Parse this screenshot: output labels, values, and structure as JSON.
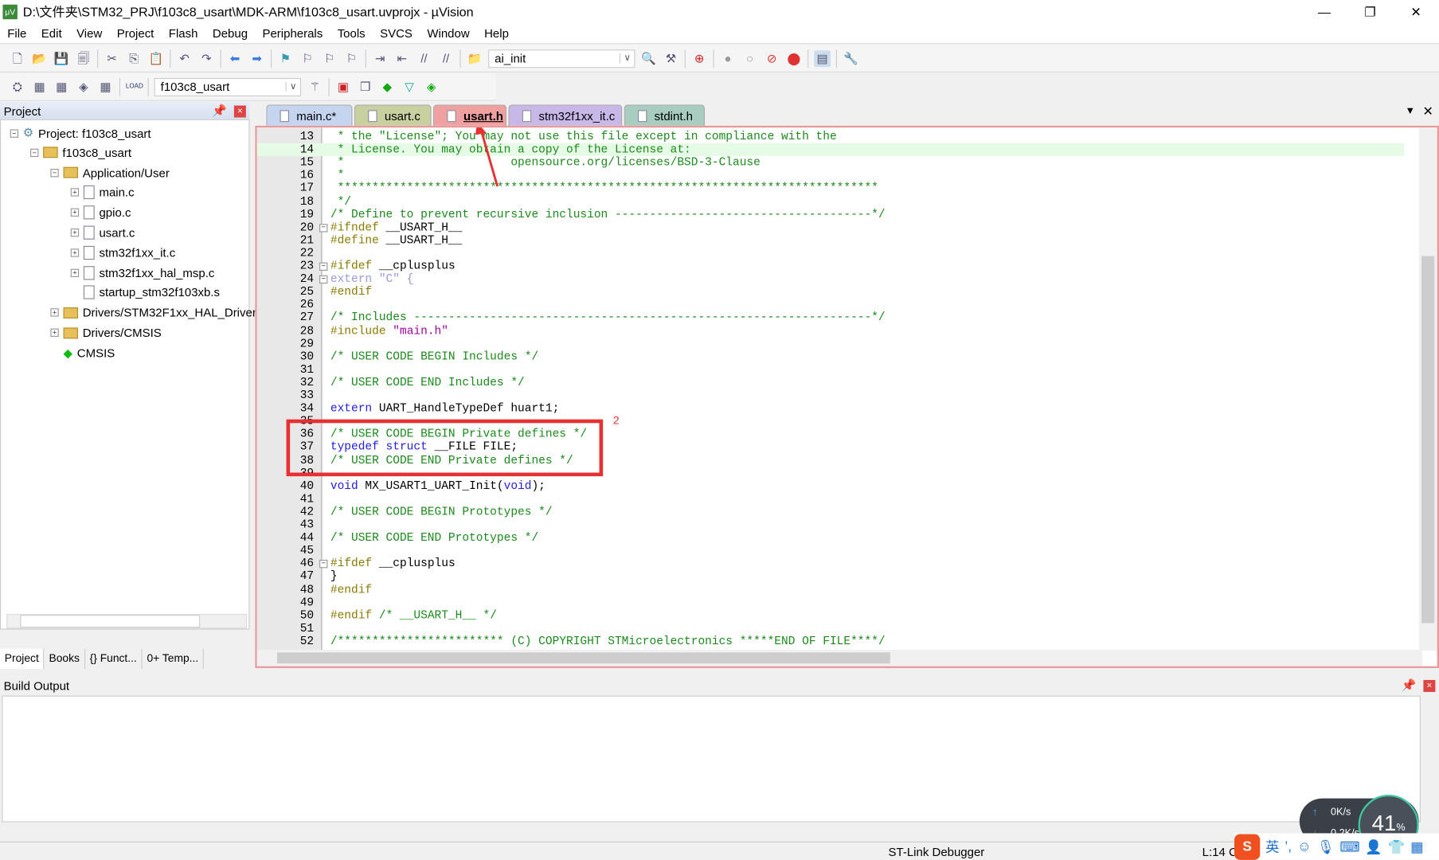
{
  "window": {
    "title": "D:\\文件夹\\STM32_PRJ\\f103c8_usart\\MDK-ARM\\f103c8_usart.uvprojx - µVision",
    "minimize": "—",
    "maximize": "❐",
    "close": "✕"
  },
  "menu": [
    "File",
    "Edit",
    "View",
    "Project",
    "Flash",
    "Debug",
    "Peripherals",
    "Tools",
    "SVCS",
    "Window",
    "Help"
  ],
  "toolbar1": {
    "find_value": "ai_init"
  },
  "toolbar2": {
    "target_value": "f103c8_usart",
    "load_label": "LOAD"
  },
  "project_panel": {
    "title": "Project",
    "tree": [
      {
        "label": "Project: f103c8_usart",
        "depth": 0,
        "expander": "−",
        "icon": "project"
      },
      {
        "label": "f103c8_usart",
        "depth": 1,
        "expander": "−",
        "icon": "target"
      },
      {
        "label": "Application/User",
        "depth": 2,
        "expander": "−",
        "icon": "folder"
      },
      {
        "label": "main.c",
        "depth": 3,
        "expander": "+",
        "icon": "file"
      },
      {
        "label": "gpio.c",
        "depth": 3,
        "expander": "+",
        "icon": "file"
      },
      {
        "label": "usart.c",
        "depth": 3,
        "expander": "+",
        "icon": "file"
      },
      {
        "label": "stm32f1xx_it.c",
        "depth": 3,
        "expander": "+",
        "icon": "file"
      },
      {
        "label": "stm32f1xx_hal_msp.c",
        "depth": 3,
        "expander": "+",
        "icon": "file"
      },
      {
        "label": "startup_stm32f103xb.s",
        "depth": 3,
        "expander": "",
        "icon": "file"
      },
      {
        "label": "Drivers/STM32F1xx_HAL_Driver",
        "depth": 2,
        "expander": "+",
        "icon": "folder"
      },
      {
        "label": "Drivers/CMSIS",
        "depth": 2,
        "expander": "+",
        "icon": "folder"
      },
      {
        "label": "CMSIS",
        "depth": 2,
        "expander": "",
        "icon": "cmsis"
      }
    ],
    "bottom_tabs": [
      "Project",
      "Books",
      "{} Funct...",
      "0+ Temp..."
    ]
  },
  "editor_tabs": [
    {
      "label": "main.c*",
      "color": "#c5d5f0"
    },
    {
      "label": "usart.c",
      "color": "#c8d0a0"
    },
    {
      "label": "usart.h",
      "color": "#f0a0a0",
      "active": true
    },
    {
      "label": "stm32f1xx_it.c",
      "color": "#c8b8e8"
    },
    {
      "label": "stdint.h",
      "color": "#a8ccc0"
    }
  ],
  "code_lines": [
    {
      "n": "13",
      "tokens": [
        [
          " * the \"License\"; You may not use this file except in compliance with the",
          "cm"
        ]
      ]
    },
    {
      "n": "14",
      "hl": true,
      "tokens": [
        [
          " * License. You may obtain a copy of the License at:",
          "cm"
        ]
      ]
    },
    {
      "n": "15",
      "tokens": [
        [
          " *                        opensource.org/licenses/BSD-3-Clause",
          "cm"
        ]
      ]
    },
    {
      "n": "16",
      "tokens": [
        [
          " *",
          "cm"
        ]
      ]
    },
    {
      "n": "17",
      "tokens": [
        [
          " ******************************************************************************",
          "cm"
        ]
      ]
    },
    {
      "n": "18",
      "tokens": [
        [
          " */",
          "cm"
        ]
      ]
    },
    {
      "n": "19",
      "tokens": [
        [
          "/* Define to prevent recursive inclusion -------------------------------------*/",
          "cm"
        ]
      ]
    },
    {
      "n": "20",
      "fold": true,
      "tokens": [
        [
          "#ifndef",
          "pp"
        ],
        [
          " __USART_H__",
          ""
        ]
      ]
    },
    {
      "n": "21",
      "tokens": [
        [
          "#define",
          "pp"
        ],
        [
          " __USART_H__",
          ""
        ]
      ]
    },
    {
      "n": "22",
      "tokens": []
    },
    {
      "n": "23",
      "fold": true,
      "tokens": [
        [
          "#ifdef",
          "pp"
        ],
        [
          " __cplusplus",
          ""
        ]
      ]
    },
    {
      "n": "24",
      "fold": true,
      "tokens": [
        [
          "extern \"C\" {",
          "fd"
        ]
      ]
    },
    {
      "n": "25",
      "tokens": [
        [
          "#endif",
          "pp"
        ]
      ]
    },
    {
      "n": "26",
      "tokens": []
    },
    {
      "n": "27",
      "tokens": [
        [
          "/* Includes ------------------------------------------------------------------*/",
          "cm"
        ]
      ]
    },
    {
      "n": "28",
      "tokens": [
        [
          "#include ",
          "pp"
        ],
        [
          "\"main.h\"",
          "st"
        ]
      ]
    },
    {
      "n": "29",
      "tokens": []
    },
    {
      "n": "30",
      "tokens": [
        [
          "/* USER CODE BEGIN Includes */",
          "cm"
        ]
      ]
    },
    {
      "n": "31",
      "tokens": []
    },
    {
      "n": "32",
      "tokens": [
        [
          "/* USER CODE END Includes */",
          "cm"
        ]
      ]
    },
    {
      "n": "33",
      "tokens": []
    },
    {
      "n": "34",
      "tokens": [
        [
          "extern",
          "kw"
        ],
        [
          " UART_HandleTypeDef huart1;",
          ""
        ]
      ]
    },
    {
      "n": "35",
      "tokens": []
    },
    {
      "n": "36",
      "tokens": [
        [
          "/* USER CODE BEGIN Private defines */",
          "cm"
        ]
      ]
    },
    {
      "n": "37",
      "tokens": [
        [
          "typedef struct",
          "kw"
        ],
        [
          " __FILE FILE;",
          ""
        ]
      ]
    },
    {
      "n": "38",
      "tokens": [
        [
          "/* USER CODE END Private defines */",
          "cm"
        ]
      ]
    },
    {
      "n": "39",
      "tokens": []
    },
    {
      "n": "40",
      "tokens": [
        [
          "void",
          "kw"
        ],
        [
          " MX_USART1_UART_Init(",
          ""
        ],
        [
          "void",
          "kw"
        ],
        [
          ");",
          ""
        ]
      ]
    },
    {
      "n": "41",
      "tokens": []
    },
    {
      "n": "42",
      "tokens": [
        [
          "/* USER CODE BEGIN Prototypes */",
          "cm"
        ]
      ]
    },
    {
      "n": "43",
      "tokens": []
    },
    {
      "n": "44",
      "tokens": [
        [
          "/* USER CODE END Prototypes */",
          "cm"
        ]
      ]
    },
    {
      "n": "45",
      "tokens": []
    },
    {
      "n": "46",
      "fold": true,
      "tokens": [
        [
          "#ifdef",
          "pp"
        ],
        [
          " __cplusplus",
          ""
        ]
      ]
    },
    {
      "n": "47",
      "tokens": [
        [
          "}",
          ""
        ]
      ]
    },
    {
      "n": "48",
      "tokens": [
        [
          "#endif",
          "pp"
        ]
      ]
    },
    {
      "n": "49",
      "tokens": []
    },
    {
      "n": "50",
      "tokens": [
        [
          "#endif",
          "pp"
        ],
        [
          " /* __USART_H__ */",
          "cm"
        ]
      ]
    },
    {
      "n": "51",
      "tokens": []
    },
    {
      "n": "52",
      "tokens": [
        [
          "/************************ (C) COPYRIGHT STMicroelectronics *****END OF FILE****/",
          "cm"
        ]
      ]
    }
  ],
  "annotation": {
    "label": "2",
    "color": "#e83030"
  },
  "build_output": {
    "title": "Build Output"
  },
  "status": {
    "debugger": "ST-Link Debugger",
    "position": "L:14 C:"
  },
  "overlay": {
    "upload": "0K/s",
    "download": "0.2K/s",
    "cpu": "41",
    "cpu_unit": "%",
    "ime_lang": "英"
  }
}
